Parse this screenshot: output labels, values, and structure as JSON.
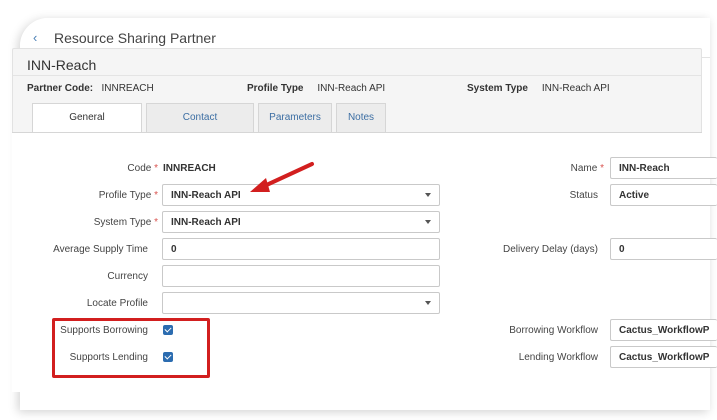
{
  "page": {
    "title": "Resource Sharing Partner"
  },
  "partner": {
    "name": "INN-Reach",
    "code_label": "Partner Code:",
    "code_value": "INNREACH",
    "profile_type_label": "Profile Type",
    "profile_type_value": "INN-Reach API",
    "system_type_label": "System Type",
    "system_type_value": "INN-Reach API"
  },
  "tabs": [
    {
      "label": "General Information",
      "active": true
    },
    {
      "label": "Contact Information",
      "active": false
    },
    {
      "label": "Parameters",
      "active": false
    },
    {
      "label": "Notes",
      "active": false
    }
  ],
  "form": {
    "code": {
      "label": "Code",
      "required": "*",
      "value": "INNREACH"
    },
    "profile_type": {
      "label": "Profile Type",
      "required": "*",
      "value": "INN-Reach API"
    },
    "system_type": {
      "label": "System Type",
      "required": "*",
      "value": "INN-Reach API"
    },
    "average_supply_time": {
      "label": "Average Supply Time",
      "value": "0"
    },
    "currency": {
      "label": "Currency",
      "value": ""
    },
    "locate_profile": {
      "label": "Locate Profile",
      "value": ""
    },
    "supports_borrowing": {
      "label": "Supports Borrowing",
      "checked": true
    },
    "supports_lending": {
      "label": "Supports Lending",
      "checked": true
    },
    "name": {
      "label": "Name",
      "required": "*",
      "value": "INN-Reach"
    },
    "status": {
      "label": "Status",
      "value": "Active"
    },
    "delivery_delay": {
      "label": "Delivery Delay (days)",
      "value": "0"
    },
    "borrowing_workflow": {
      "label": "Borrowing Workflow",
      "value": "Cactus_WorkflowP"
    },
    "lending_workflow": {
      "label": "Lending Workflow",
      "value": "Cactus_WorkflowP"
    }
  },
  "annotation": {
    "arrow_color": "#d21f1f",
    "box_color": "#d21f1f"
  },
  "colors": {
    "checkbox": "#2b6cb0",
    "link": "#3c6ea3",
    "required": "#d9534f"
  }
}
